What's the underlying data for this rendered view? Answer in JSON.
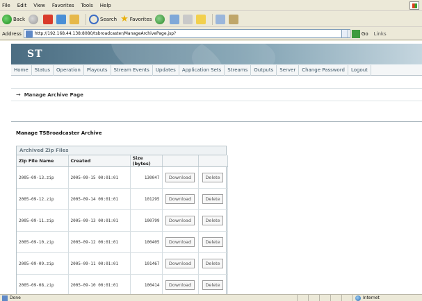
{
  "browser": {
    "menu": [
      "File",
      "Edit",
      "View",
      "Favorites",
      "Tools",
      "Help"
    ],
    "toolbar": {
      "back": "Back",
      "search": "Search",
      "favorites": "Favorites"
    },
    "address_label": "Address",
    "address_url": "http://192.168.44.138:8080/tsbroadcaster/ManageArchivePage.jsp?",
    "go_label": "Go",
    "links_label": "Links",
    "status_text": "Done",
    "zone_text": "Internet"
  },
  "site": {
    "logo": "ST",
    "nav": [
      "Home",
      "Status",
      "Operation",
      "Playouts",
      "Stream Events",
      "Updates",
      "Application Sets",
      "Streams",
      "Outputs",
      "Server",
      "Change Password",
      "Logout"
    ]
  },
  "page": {
    "header_title": "Manage Archive Page",
    "section_title": "Manage TSBroadcaster Archive",
    "archive_caption": "Archived Zip Files",
    "columns": [
      "Zip File Name",
      "Created",
      "Size (bytes)",
      "",
      ""
    ],
    "download_label": "Download",
    "delete_label": "Delete",
    "rows": [
      {
        "name": "2005-09-13.zip",
        "created": "2005-09-15 00:01:01",
        "size": "130047"
      },
      {
        "name": "2005-09-12.zip",
        "created": "2005-09-14 00:01:01",
        "size": "101295"
      },
      {
        "name": "2005-09-11.zip",
        "created": "2005-09-13 00:01:01",
        "size": "100799"
      },
      {
        "name": "2005-09-10.zip",
        "created": "2005-09-12 00:01:01",
        "size": "100405"
      },
      {
        "name": "2005-09-09.zip",
        "created": "2005-09-11 00:01:01",
        "size": "101467"
      },
      {
        "name": "2005-09-08.zip",
        "created": "2005-09-10 00:01:01",
        "size": "100414"
      }
    ]
  }
}
